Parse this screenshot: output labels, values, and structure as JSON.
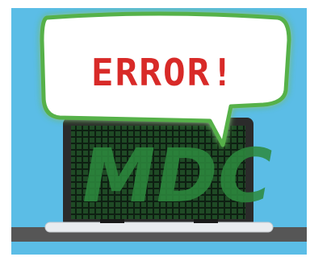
{
  "illustration": {
    "speech_bubble_text": "ERROR!",
    "screen_text": "MDC",
    "colors": {
      "sky": "#5bbde6",
      "bubble_fill": "#ffffff",
      "bubble_border": "#56b148",
      "error_red": "#d82a28",
      "laptop_body": "#2b2b2b",
      "screen_bg": "#0e1f12",
      "screen_grid_green": "#3aa34c",
      "base_silver": "#e9ecef",
      "table": "#565656"
    },
    "icons": [
      "speech-bubble-icon",
      "laptop-icon"
    ]
  }
}
